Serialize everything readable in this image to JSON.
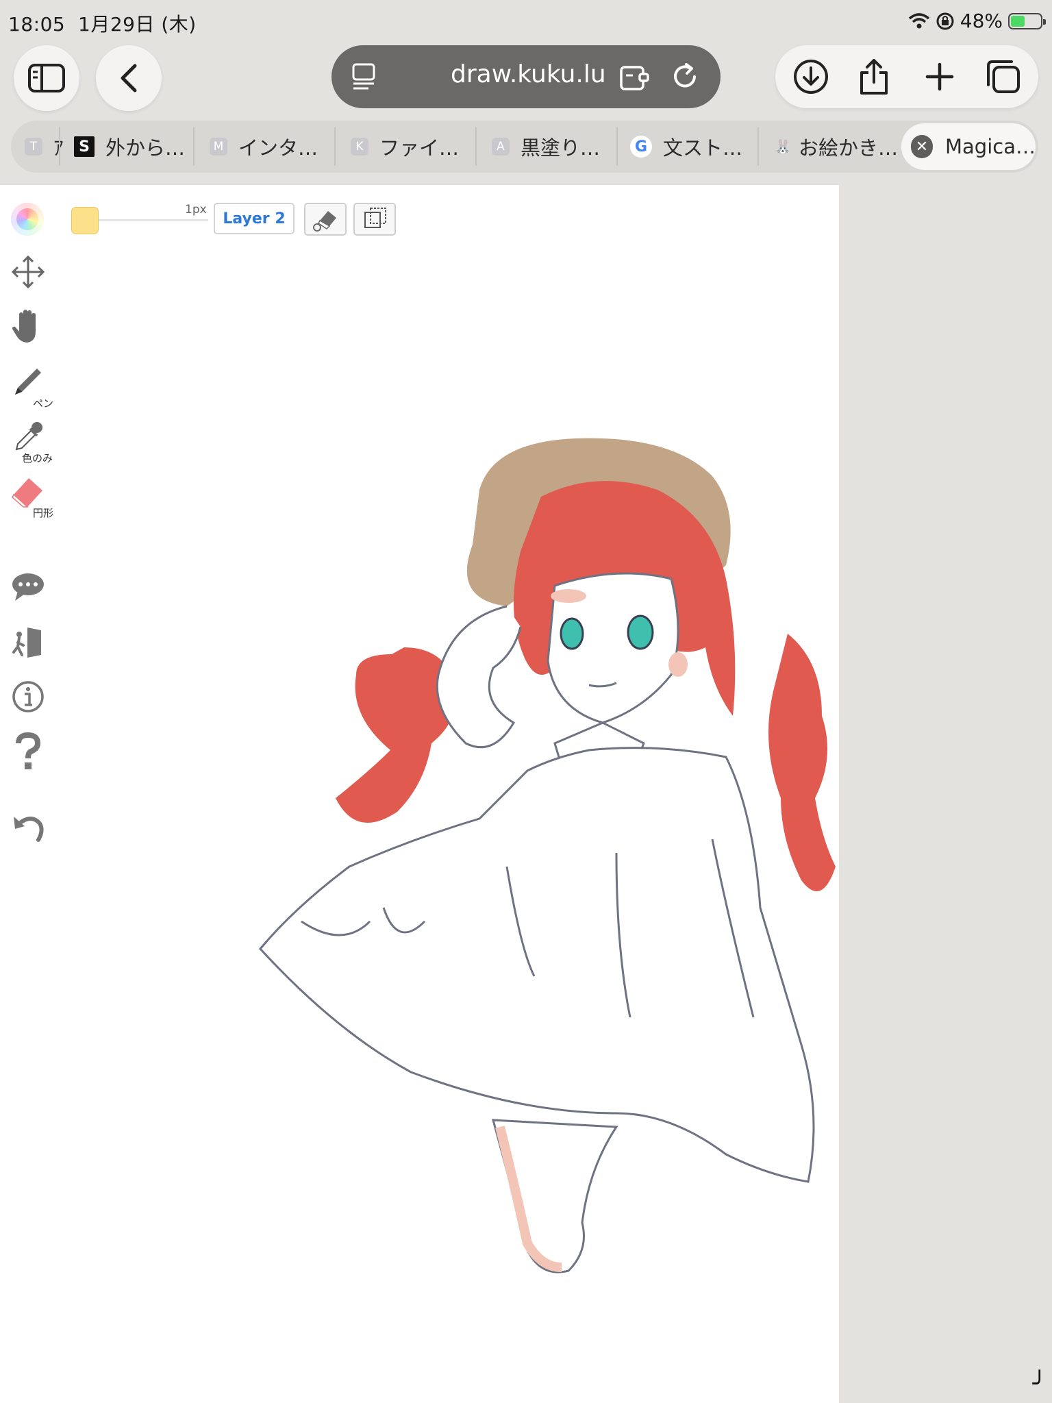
{
  "status": {
    "time": "18:05",
    "date": "1月29日 (木)",
    "battery": "48%",
    "battery_level": 0.48
  },
  "toolbar": {
    "url": "draw.kuku.lu",
    "icons": [
      "sidebar-icon",
      "back-icon",
      "tab-overview-icon",
      "extensions-icon",
      "reload-icon",
      "download-icon",
      "share-icon",
      "plus-icon",
      "tabs-icon"
    ]
  },
  "tabs": [
    {
      "fav_letter": "T",
      "label": "ｱ",
      "fav_color": "#c9c8cc"
    },
    {
      "fav_letter": "S",
      "label": "外から…",
      "fav_color": "#111111"
    },
    {
      "fav_letter": "M",
      "label": "インタ…",
      "fav_color": "#c9c8cc"
    },
    {
      "fav_letter": "K",
      "label": "ファイ…",
      "fav_color": "#c9c8cc"
    },
    {
      "fav_letter": "A",
      "label": "黒塗り…",
      "fav_color": "#c9c8cc"
    },
    {
      "fav_letter": "G",
      "label": "文スト…",
      "fav_color": "#ffffff"
    },
    {
      "fav_letter": "🐰",
      "label": "お絵かき…",
      "fav_color": "#d8d7d4"
    },
    {
      "fav_letter": "✕",
      "label": "Magica…",
      "fav_color": "#5e5d5b"
    }
  ],
  "canvas": {
    "pen_size": "1px",
    "layer": "Layer 2",
    "brush_color": "#fde08a",
    "tools": [
      {
        "name": "move",
        "label": ""
      },
      {
        "name": "hand",
        "label": ""
      },
      {
        "name": "pen",
        "label": "ペン"
      },
      {
        "name": "eyedropper",
        "label": "色のみ"
      },
      {
        "name": "eraser",
        "label": "円形"
      }
    ],
    "colors": {
      "line": "#6e7282",
      "hair": "#e05a4f",
      "hat": "#c2a587",
      "skin": "#f2c5b6",
      "eyes": "#3fbfae"
    }
  }
}
